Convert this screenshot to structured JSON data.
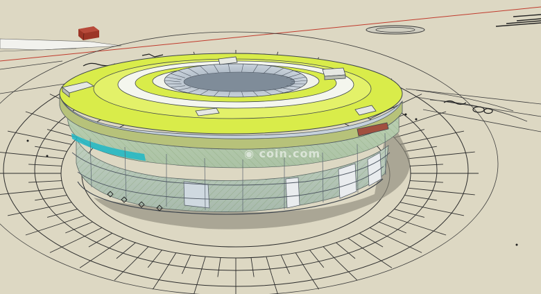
{
  "viewport": {
    "kind": "sketchup-3d-model-view",
    "background_color": "#ddd8c3",
    "ground_line_color": "#2b2b2b",
    "axis_color": "#c0392b"
  },
  "model": {
    "subject": "circular-stadium-building",
    "roof_color": "#d9ec4a",
    "glass_color": "#b9c8d4",
    "facade_green_color": "#a9c98a",
    "accent_cyan_color": "#1fb7c7",
    "shadow_color": "#8f8c7c",
    "marker_color": "#8b2f24"
  },
  "watermark": {
    "text": "coin.com",
    "icon": "logo-icon"
  }
}
